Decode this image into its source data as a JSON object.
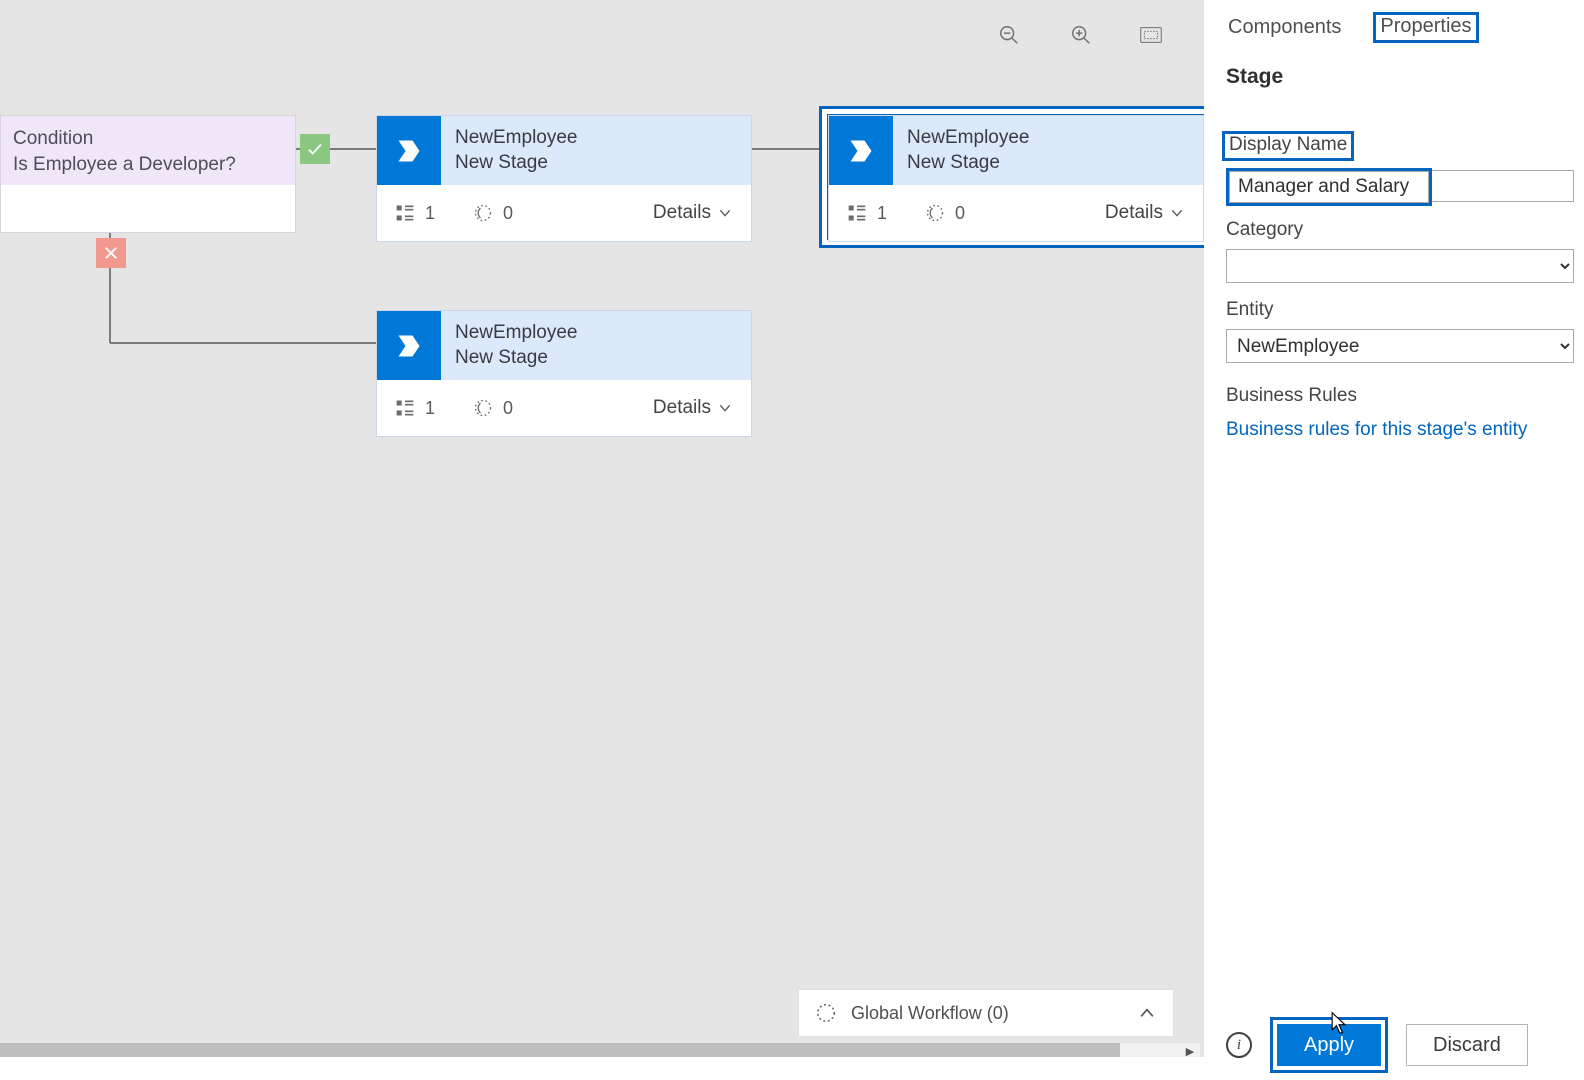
{
  "canvas": {
    "condition": {
      "type_label": "Condition",
      "question": "Is Employee a Developer?"
    },
    "stages": {
      "s1": {
        "entity": "NewEmployee",
        "name": "New Stage",
        "steps": "1",
        "workflows": "0",
        "details": "Details"
      },
      "s2": {
        "entity": "NewEmployee",
        "name": "New Stage",
        "steps": "1",
        "workflows": "0",
        "details": "Details"
      },
      "s3": {
        "entity": "NewEmployee",
        "name": "New Stage",
        "steps": "1",
        "workflows": "0",
        "details": "Details"
      }
    },
    "global_workflow_label": "Global Workflow (0)"
  },
  "panel": {
    "tabs": {
      "components": "Components",
      "properties": "Properties"
    },
    "title": "Stage",
    "display_name_label": "Display Name",
    "display_name_value": "Manager and Salary",
    "category_label": "Category",
    "category_value": "",
    "entity_label": "Entity",
    "entity_value": "NewEmployee",
    "business_rules_label": "Business Rules",
    "business_rules_link": "Business rules for this stage's entity",
    "apply": "Apply",
    "discard": "Discard"
  }
}
